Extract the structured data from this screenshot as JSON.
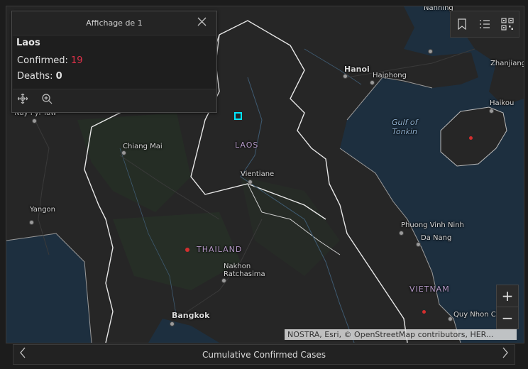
{
  "popup": {
    "header": "Affichage de 1",
    "title": "Laos",
    "confirmed_label": "Confirmed:",
    "confirmed_value": "19",
    "deaths_label": "Deaths:",
    "deaths_value": "0"
  },
  "map_labels": {
    "nanning": "Nanning",
    "hanoi": "Hanoi",
    "haiphong": "Haiphong",
    "zhanjiang": "Zhanjiang",
    "haikou": "Haikou",
    "nay_pyi_taw": "Nay Pyi Taw",
    "chiang_mai": "Chiang Mai",
    "laos": "LAOS",
    "vientiane": "Vientiane",
    "yangon": "Yangon",
    "thailand": "THAILAND",
    "nakhon_line1": "Nakhon",
    "nakhon_line2": "Ratchasima",
    "bangkok": "Bangkok",
    "phuong_vinh_ninh": "Phuong Vinh Ninh",
    "da_nang": "Da Nang",
    "vietnam": "VIETNAM",
    "quy_nhon": "Quy Nhon Ci",
    "gulf_line1": "Gulf of",
    "gulf_line2": "Tonkin"
  },
  "attribution": "NOSTRA, Esri, © OpenStreetMap contributors, HER...",
  "bottom_bar": {
    "title": "Cumulative Confirmed Cases"
  },
  "zoom": {
    "in": "+",
    "out": "−"
  },
  "icons": {
    "close": "close-icon",
    "pan": "pan-icon",
    "zoom_to": "zoom-to-icon",
    "bookmark": "bookmark-icon",
    "legend": "legend-icon",
    "qr": "qr-code-icon",
    "prev": "chevron-left-icon",
    "next": "chevron-right-icon"
  },
  "colors": {
    "case_dot": "#d32f2f",
    "highlight": "#00e5ff",
    "confirmed": "#e2314a"
  }
}
